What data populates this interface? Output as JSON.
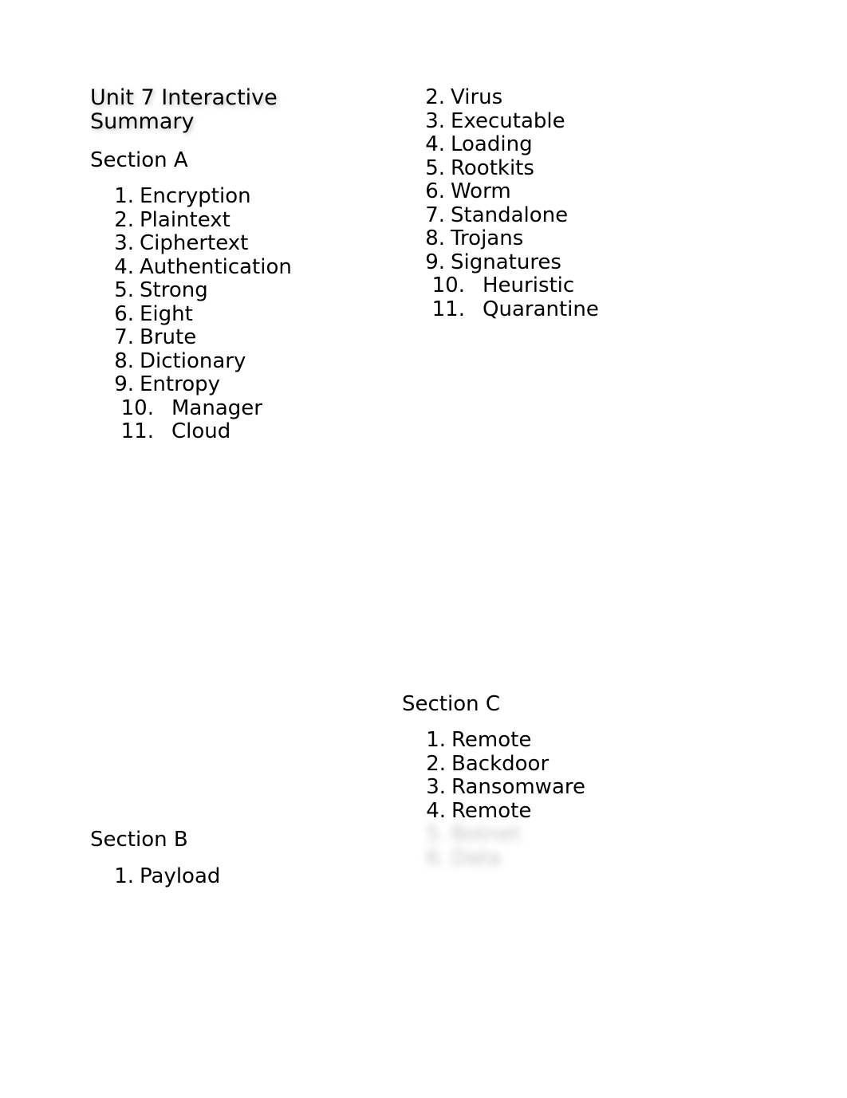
{
  "title_line1": "Unit 7 Interactive",
  "title_line2": "Summary",
  "sections": {
    "a": {
      "heading": "Section A",
      "items": [
        "Encryption",
        "Plaintext",
        "Ciphertext",
        "Authentication",
        "Strong",
        "Eight",
        "Brute",
        "Dictionary",
        "Entropy",
        "Manager",
        "Cloud"
      ]
    },
    "right_continuation": {
      "start_number": 2,
      "items": [
        "Virus",
        "Executable",
        "Loading",
        "Rootkits",
        "Worm",
        "Standalone",
        "Trojans",
        "Signatures",
        "Heuristic",
        "Quarantine"
      ]
    },
    "b": {
      "heading": "Section B",
      "items": [
        "Payload"
      ]
    },
    "c": {
      "heading": "Section C",
      "items": [
        "Remote",
        "Backdoor",
        "Ransomware",
        "Remote"
      ],
      "blurred_items": [
        "Botnet",
        "Data"
      ]
    }
  }
}
